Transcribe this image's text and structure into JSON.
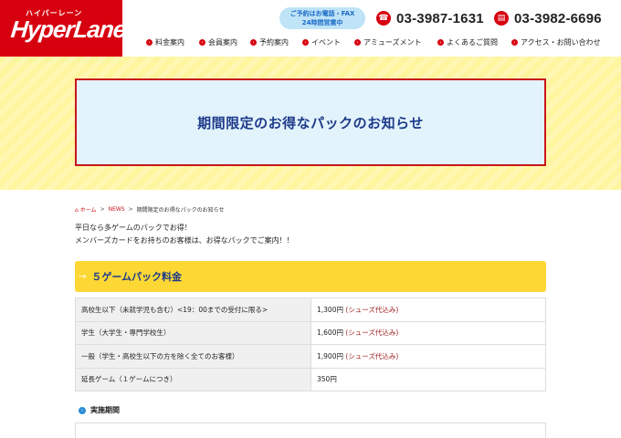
{
  "header": {
    "logo_kana": "ハイパーレーン",
    "logo_text": "HyperLane",
    "badge_line1": "ご予約はお電話・FAX",
    "badge_line2": "24時間営業中",
    "phone_tel": "03-3987-1631",
    "phone_fax": "03-3982-6696",
    "nav": [
      {
        "label": "料金案内"
      },
      {
        "label": "会員案内"
      },
      {
        "label": "予約案内"
      },
      {
        "label": "イベント"
      },
      {
        "label": "アミューズメント"
      },
      {
        "label": "よくあるご質問"
      },
      {
        "label": "アクセス・お問い合わせ"
      }
    ]
  },
  "hero": {
    "title": "期間限定のお得なパックのお知らせ"
  },
  "breadcrumb": {
    "home": "ホーム",
    "news": "NEWS",
    "current": "期間限定のお得なパックのお知らせ"
  },
  "intro": {
    "line1": "平日なら多ゲームのパックでお得！",
    "line2": "メンバーズカードをお持ちのお客様は、お得なパックでご案内！！"
  },
  "section": {
    "title": "５ゲームパック料金"
  },
  "price_table": [
    {
      "label": "高校生以下（未就学児も含む）<19：00までの受付に限る>",
      "price": "1,300円",
      "note": "(シューズ代込み)"
    },
    {
      "label": "学生（大学生・専門学校生）",
      "price": "1,600円",
      "note": "(シューズ代込み)"
    },
    {
      "label": "一般（学生・高校生以下の方を除く全てのお客様）",
      "price": "1,900円",
      "note": "(シューズ代込み)"
    },
    {
      "label": "延長ゲーム（１ゲームにつき）",
      "price": "350円",
      "note": ""
    }
  ],
  "period": {
    "title": "実施期間"
  },
  "colors": {
    "brand_red": "#d7000f",
    "heading_blue": "#1d3a8a",
    "section_yellow": "#fdd835",
    "hero_box_bg": "#e2f3fb"
  }
}
